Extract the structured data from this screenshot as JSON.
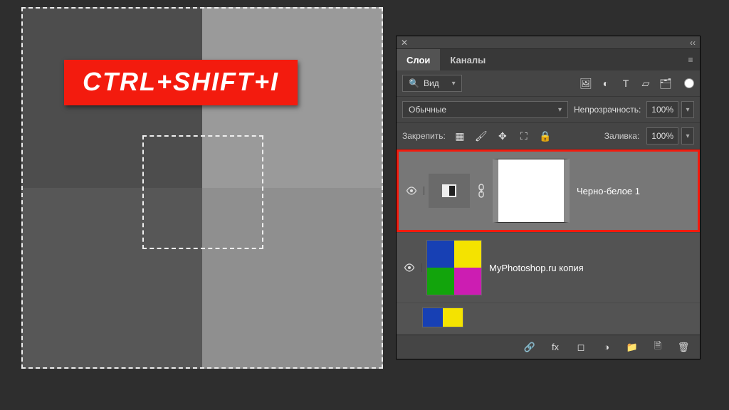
{
  "shortcut": "CTRL+SHIFT+I",
  "panel": {
    "tabs": {
      "layers": "Слои",
      "channels": "Каналы"
    },
    "kindFilter": "Вид",
    "blendMode": "Обычные",
    "opacityLabel": "Непрозрачность:",
    "opacityValue": "100%",
    "lockLabel": "Закрепить:",
    "fillLabel": "Заливка:",
    "fillValue": "100%"
  },
  "layers": [
    {
      "name": "Черно-белое 1"
    },
    {
      "name": "MyPhotoshop.ru копия"
    }
  ],
  "iconGlyphs": {
    "close": "✕",
    "collapse": "‹‹",
    "menu": "≡",
    "chevDown": "▾",
    "search": "🔍",
    "image": "🖼",
    "contrast": "◐",
    "text": "T",
    "shape": "▱",
    "smart": "🗂",
    "eye": "👁",
    "link": "🔗",
    "checker": "▦",
    "brush": "🖌",
    "move": "✥",
    "crop": "⛶",
    "lock": "🔒",
    "fx": "fx",
    "maskBtn": "◻",
    "adjust": "◑",
    "folder": "📁",
    "new": "🗎",
    "trash": "🗑"
  }
}
